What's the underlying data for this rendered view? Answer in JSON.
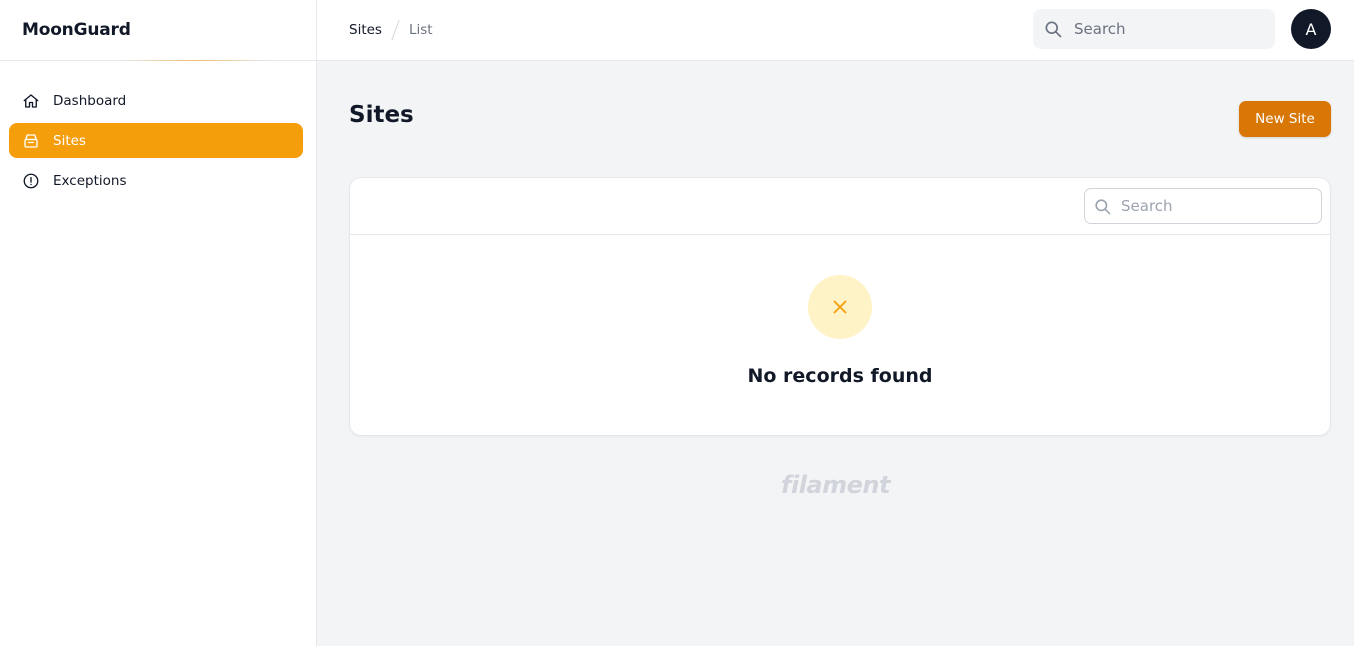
{
  "brand": {
    "name": "MoonGuard"
  },
  "sidebar": {
    "items": [
      {
        "label": "Dashboard",
        "icon": "home-icon",
        "active": false
      },
      {
        "label": "Sites",
        "icon": "archive-icon",
        "active": true
      },
      {
        "label": "Exceptions",
        "icon": "exclamation-circle-icon",
        "active": false
      }
    ]
  },
  "topbar": {
    "breadcrumb": {
      "current": "Sites",
      "list": "List"
    },
    "search_placeholder": "Search",
    "avatar_initial": "A"
  },
  "main": {
    "title": "Sites",
    "new_button_label": "New Site",
    "table": {
      "search_placeholder": "Search",
      "empty_message": "No records found"
    },
    "footer_brand": "filament"
  },
  "colors": {
    "accent": "#f59e0b",
    "button": "#d97706",
    "empty_icon_bg": "#fef3c7",
    "avatar_bg": "#111827"
  }
}
